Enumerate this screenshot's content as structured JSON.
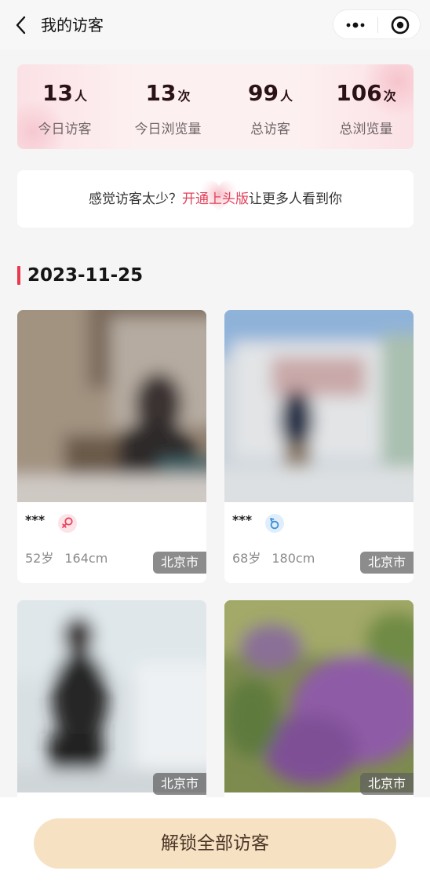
{
  "nav": {
    "title": "我的访客",
    "back_icon": "chevron-left-icon",
    "more_icon": "more-dots-icon",
    "close_icon": "target-icon"
  },
  "stats": [
    {
      "value": "13",
      "unit": "人",
      "label": "今日访客"
    },
    {
      "value": "13",
      "unit": "次",
      "label": "今日浏览量"
    },
    {
      "value": "99",
      "unit": "人",
      "label": "总访客"
    },
    {
      "value": "106",
      "unit": "次",
      "label": "总浏览量"
    }
  ],
  "promo": {
    "prefix": "感觉访客太少？",
    "link": "开通上头版",
    "suffix": "让更多人看到你"
  },
  "date": "2023-11-25",
  "visitors": [
    {
      "name": "***",
      "gender": "female",
      "age": "52岁",
      "height": "164cm",
      "city": "北京市"
    },
    {
      "name": "***",
      "gender": "male",
      "age": "68岁",
      "height": "180cm",
      "city": "北京市"
    },
    {
      "city": "北京市"
    },
    {
      "city": "北京市"
    }
  ],
  "bottom": {
    "unlock_label": "解锁全部访客"
  },
  "colors": {
    "accent": "#e8394f",
    "link": "#e0405a",
    "unlock_bg": "#f6e1c3"
  }
}
